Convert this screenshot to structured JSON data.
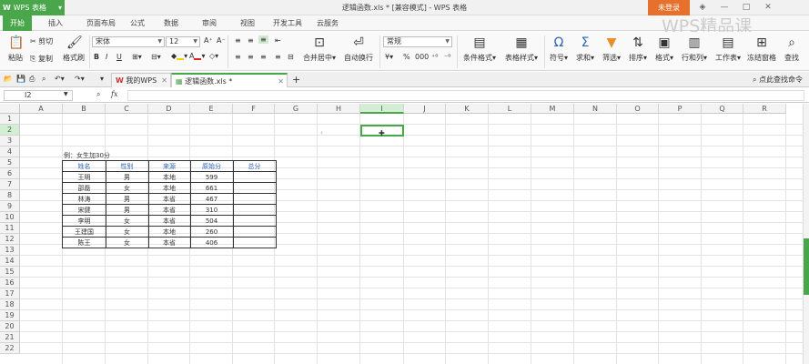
{
  "app": {
    "name": "WPS 表格",
    "title": "逻辑函数.xls * [兼容模式] - WPS 表格",
    "login": "未登录",
    "watermark": "WPS精品课"
  },
  "menu_tabs": [
    "开始",
    "插入",
    "页面布局",
    "公式",
    "数据",
    "审阅",
    "视图",
    "开发工具",
    "云服务"
  ],
  "ribbon": {
    "paste": "粘贴",
    "cut": "剪切",
    "copy": "复制",
    "format_painter": "格式刷",
    "font_name": "宋体",
    "font_size": "12",
    "merge_center": "合并居中",
    "wrap_text": "自动换行",
    "number_format": "常规",
    "conditional_format": "条件格式",
    "table_style": "表格样式",
    "symbol": "符号",
    "sum": "求和",
    "filter": "筛选",
    "sort": "排序",
    "format": "格式",
    "row_col": "行和列",
    "sheet": "工作表",
    "freeze": "冻结窗格",
    "find": "查找",
    "bold": "B",
    "italic": "I",
    "underline": "U",
    "font_color_glyph": "A",
    "percent_glyph": "%",
    "thousands_glyph": "000",
    "symbol_glyph": "Ω",
    "sum_glyph": "Σ"
  },
  "doc_tabs": [
    "我的WPS",
    "逻辑函数.xls *"
  ],
  "search_cmd": "点此查找命令",
  "namebox": "I2",
  "columns": [
    "A",
    "B",
    "C",
    "D",
    "E",
    "F",
    "G",
    "H",
    "I",
    "J",
    "K",
    "L",
    "M",
    "N",
    "O",
    "P",
    "Q",
    "R"
  ],
  "rows": [
    "1",
    "2",
    "3",
    "4",
    "5",
    "6",
    "7",
    "8",
    "9",
    "10",
    "11",
    "12",
    "13",
    "14",
    "15",
    "16",
    "17",
    "18",
    "19",
    "20",
    "21",
    "22"
  ],
  "selected_col": "I",
  "selected_row": "2",
  "caption": "例：女生加30分",
  "table": {
    "headers": [
      "姓名",
      "性别",
      "来源",
      "原始分",
      "总分"
    ],
    "rows": [
      [
        "王明",
        "男",
        "本地",
        "599",
        ""
      ],
      [
        "邵磊",
        "女",
        "本地",
        "661",
        ""
      ],
      [
        "林涛",
        "男",
        "本省",
        "467",
        ""
      ],
      [
        "宋健",
        "男",
        "本省",
        "310",
        ""
      ],
      [
        "李明",
        "女",
        "本省",
        "504",
        ""
      ],
      [
        "王建国",
        "女",
        "本地",
        "260",
        ""
      ],
      [
        "陈王",
        "女",
        "本省",
        "406",
        ""
      ]
    ]
  }
}
